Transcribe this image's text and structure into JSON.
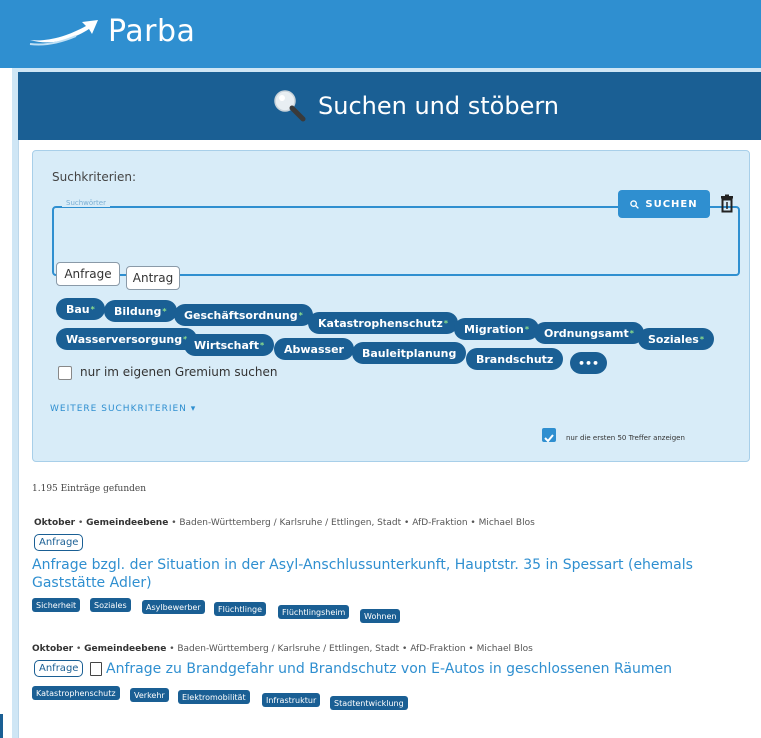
{
  "app": {
    "title": "Parba"
  },
  "header": {
    "title": "Suchen und stöbern"
  },
  "search": {
    "criteria_label": "Suchkriterien:",
    "field_label": "Suchwörter",
    "value": "",
    "button_label": "SUCHEN",
    "types": [
      "Anfrage",
      "Antrag"
    ],
    "topics": [
      {
        "label": "Bau",
        "star": "*"
      },
      {
        "label": "Bildung",
        "star": "*"
      },
      {
        "label": "Geschäftsordnung",
        "star": "*"
      },
      {
        "label": "Katastrophenschutz",
        "star": "*"
      },
      {
        "label": "Migration",
        "star": "*"
      },
      {
        "label": "Ordnungsamt",
        "star": "*"
      },
      {
        "label": "Soziales",
        "star": "*"
      },
      {
        "label": "Wasserversorgung",
        "star": "*"
      },
      {
        "label": "Wirtschaft",
        "star": "*"
      },
      {
        "label": "Abwasser",
        "star": ""
      },
      {
        "label": "Bauleitplanung",
        "star": ""
      },
      {
        "label": "Brandschutz",
        "star": ""
      },
      {
        "label": "•••",
        "star": ""
      }
    ],
    "own_committee_label": "nur im eigenen Gremium suchen",
    "own_committee_checked": false,
    "more_criteria_label": "WEITERE SUCHKRITERIEN ▾",
    "first50_label": "nur die ersten 50 Treffer anzeigen",
    "first50_checked": true
  },
  "results": {
    "count_label": "1.195 Einträge gefunden",
    "items": [
      {
        "month": "Oktober",
        "level": "Gemeindeebene",
        "meta": " • Baden-Württemberg / Karlsruhe / Ettlingen, Stadt • AfD-Fraktion • Michael Blos",
        "kind": "Anfrage",
        "title": "Anfrage bzgl. der Situation in der Asyl-Anschlussunterkunft, Hauptstr. 35 in Spessart (ehemals Gaststätte Adler)",
        "tags": [
          "Sicherheit",
          "Soziales",
          "Asylbewerber",
          "Flüchtlinge",
          "Flüchtlingsheim",
          "Wohnen"
        ]
      },
      {
        "month": "Oktober",
        "level": "Gemeindeebene",
        "meta": " • Baden-Württemberg / Karlsruhe / Ettlingen, Stadt • AfD-Fraktion • Michael Blos",
        "kind": "Anfrage",
        "title": "Anfrage zu Brandgefahr und Brandschutz von E-Autos in geschlossenen Räumen",
        "tags": [
          "Katastrophenschutz",
          "Verkehr",
          "Elektromobilität",
          "Infrastruktur",
          "Stadtentwicklung"
        ]
      }
    ]
  },
  "colors": {
    "brand": "#2f8fd0",
    "dark": "#1a5f94",
    "panel": "#d8ecf8",
    "star": "#8de08d"
  }
}
